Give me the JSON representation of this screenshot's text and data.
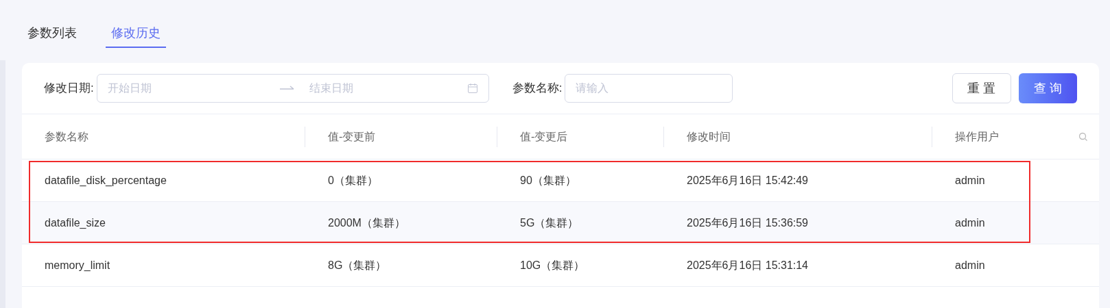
{
  "tabs": [
    {
      "label": "参数列表",
      "selected": false
    },
    {
      "label": "修改历史",
      "selected": true
    }
  ],
  "filters": {
    "date_label": "修改日期:",
    "start_placeholder": "开始日期",
    "end_placeholder": "结束日期",
    "name_label": "参数名称:",
    "name_placeholder": "请输入"
  },
  "buttons": {
    "reset": "重 置",
    "query": "查 询"
  },
  "table": {
    "columns": [
      "参数名称",
      "值-变更前",
      "值-变更后",
      "修改时间",
      "操作用户"
    ],
    "rows": [
      {
        "cells": [
          "datafile_disk_percentage",
          "0（集群）",
          "90（集群）",
          "2025年6月16日 15:42:49",
          "admin"
        ],
        "highlighted": true
      },
      {
        "cells": [
          "datafile_size",
          "2000M（集群）",
          "5G（集群）",
          "2025年6月16日 15:36:59",
          "admin"
        ],
        "highlighted": true
      },
      {
        "cells": [
          "memory_limit",
          "8G（集群）",
          "10G（集群）",
          "2025年6月16日 15:31:14",
          "admin"
        ],
        "highlighted": false
      }
    ]
  }
}
